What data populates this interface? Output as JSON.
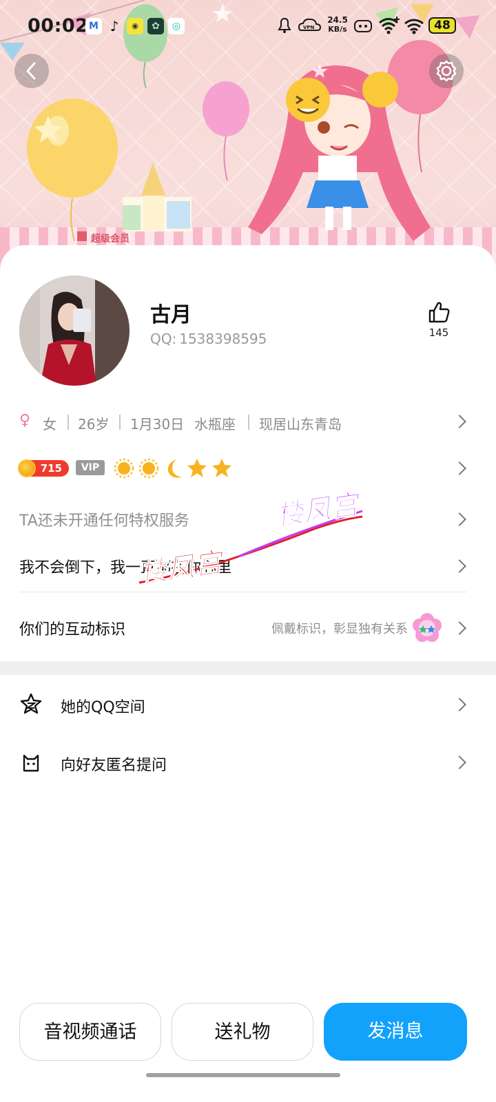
{
  "status_bar": {
    "time": "00:02",
    "net_speed_value": "24.5",
    "net_speed_unit": "KB/s",
    "vpn_label": "VPN",
    "battery": "48",
    "app_icons": [
      "gmail-icon",
      "tiktok-icon",
      "camera-app-icon",
      "chat-app-icon",
      "green-app-icon"
    ]
  },
  "hero": {
    "banner_caption": "超级会员"
  },
  "profile": {
    "name": "古月",
    "qq_label": "QQ:",
    "qq_number": "1538398595",
    "likes": "145",
    "gender": "女",
    "age": "26岁",
    "birthday": "1月30日",
    "zodiac": "水瓶座",
    "location": "现居山东青岛",
    "level": "715",
    "vip_label": "VIP",
    "privilege_text": "TA还未开通任何特权服务",
    "signature": "我不会倒下，我一直都在你心里"
  },
  "interaction_tag": {
    "label": "你们的互动标识",
    "hint": "佩戴标识，彰显独有关系"
  },
  "menu": {
    "qzone": "她的QQ空间",
    "anon_question": "向好友匿名提问"
  },
  "watermark": {
    "text1": "楼凤宫",
    "text2": "楼凤宫"
  },
  "buttons": {
    "av_call": "音视频通话",
    "gift": "送礼物",
    "message": "发消息"
  },
  "colors": {
    "primary": "#12a2fb",
    "level_badge": "#ef3b2d",
    "gender_female": "#f276a8",
    "watermark_red": "#e0202a",
    "watermark_purple": "#c13cf2"
  }
}
